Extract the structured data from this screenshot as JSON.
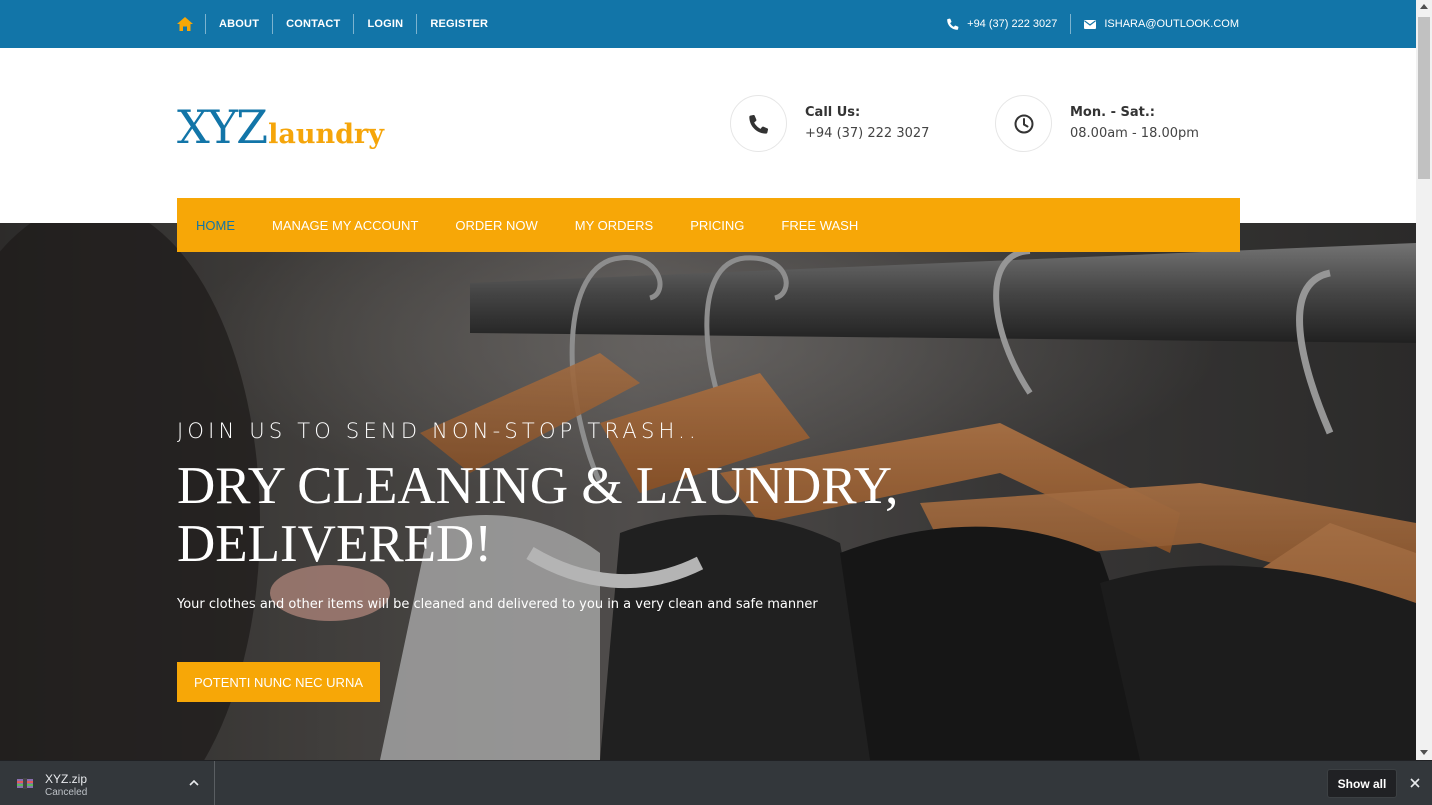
{
  "topbar": {
    "links": [
      "ABOUT",
      "CONTACT",
      "LOGIN",
      "REGISTER"
    ],
    "phone": "+94 (37) 222 3027",
    "email": "ISHARA@OUTLOOK.COM"
  },
  "header": {
    "logo_primary": "XYZ",
    "logo_secondary": "laundry",
    "call_label": "Call Us:",
    "call_value": "+94 (37) 222 3027",
    "hours_label": "Mon. - Sat.:",
    "hours_value": "08.00am - 18.00pm"
  },
  "nav": {
    "items": [
      "HOME",
      "MANAGE MY ACCOUNT",
      "ORDER NOW",
      "MY ORDERS",
      "PRICING",
      "FREE WASH"
    ],
    "active": "HOME"
  },
  "hero": {
    "subtitle": "JOIN US TO SEND NON-STOP TRASH..",
    "title": "DRY CLEANING & LAUNDRY, DELIVERED!",
    "description": "Your clothes and other items will be cleaned and delivered to you in a very clean and safe manner",
    "button": "POTENTI NUNC NEC URNA"
  },
  "download_bar": {
    "file_name": "XYZ.zip",
    "status": "Canceled",
    "show_all": "Show all"
  },
  "colors": {
    "primary_blue": "#1275a8",
    "accent_orange": "#f7a707"
  },
  "icons": {
    "home": "home-icon",
    "phone": "phone-icon",
    "email": "envelope-icon",
    "clock": "clock-icon"
  }
}
